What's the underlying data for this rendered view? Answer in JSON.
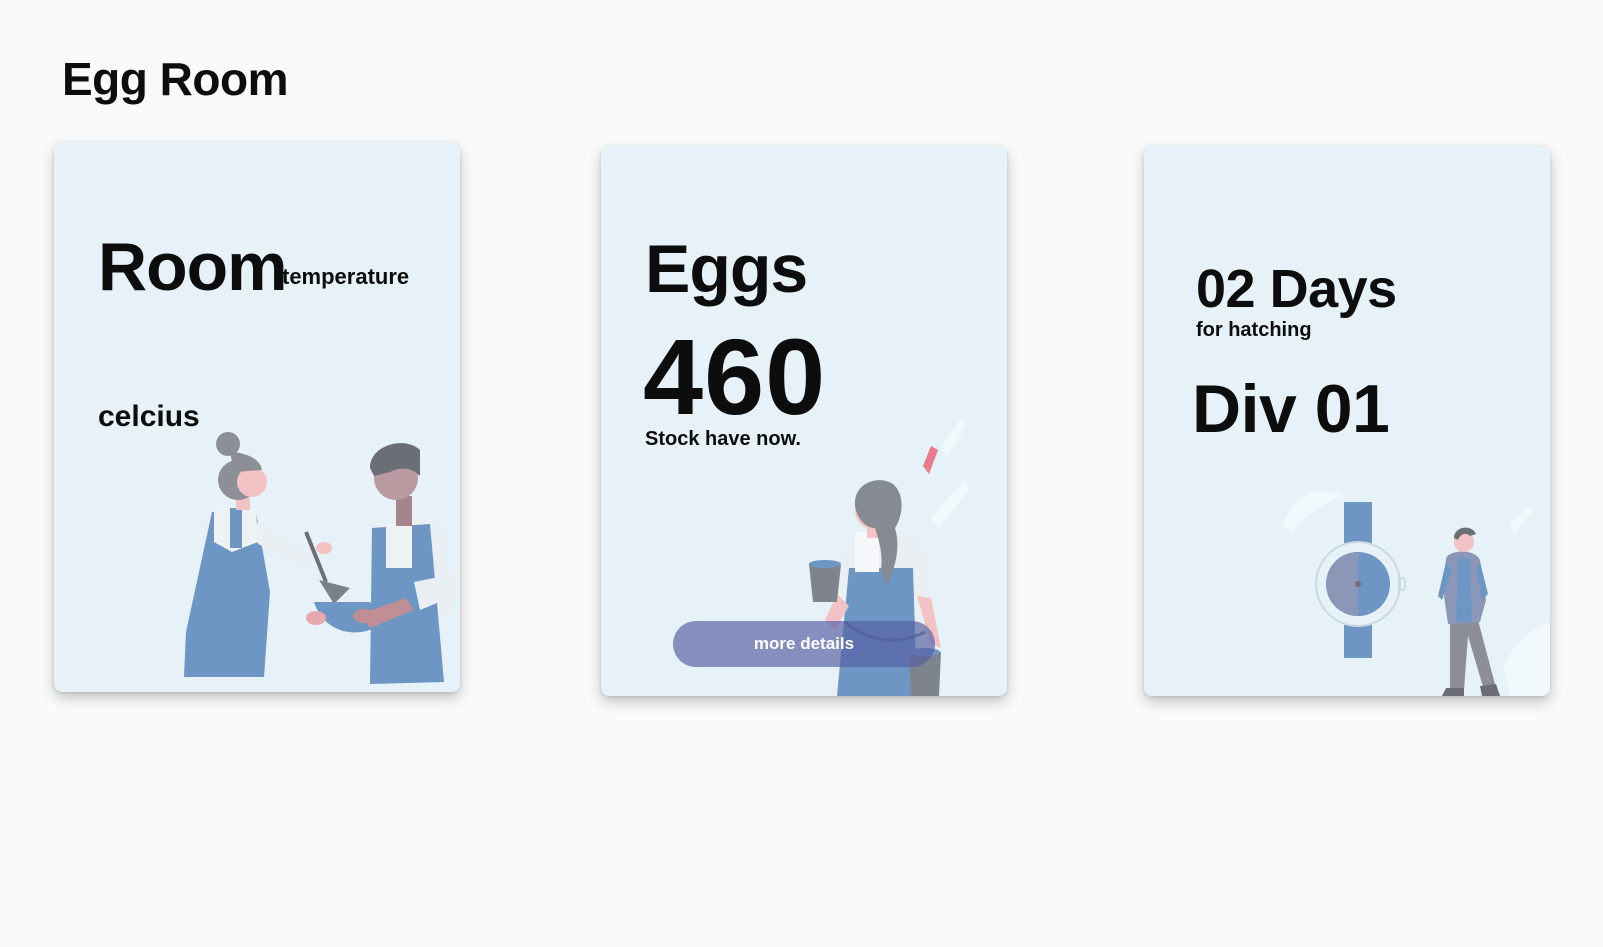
{
  "page": {
    "title": "Egg Room"
  },
  "cards": {
    "room": {
      "heading": "Room",
      "subheading": "temperature",
      "unit": "celcius",
      "illustration": "two-bakers-mixing-illustration"
    },
    "eggs": {
      "heading": "Eggs",
      "count": "460",
      "caption": "Stock have now.",
      "button_label": "more details",
      "illustration": "woman-holding-cups-illustration"
    },
    "hatching": {
      "days": "02 Days",
      "subheading": "for hatching",
      "division": "Div 01",
      "illustration": "man-with-watch-illustration"
    }
  },
  "colors": {
    "background": "#fafafa",
    "card": "#e6f2f7",
    "button": "#5660a4",
    "illustration_blue": "#6d96c4",
    "illustration_gray": "#8c8f96",
    "illustration_skin": "#f3c2c4"
  }
}
